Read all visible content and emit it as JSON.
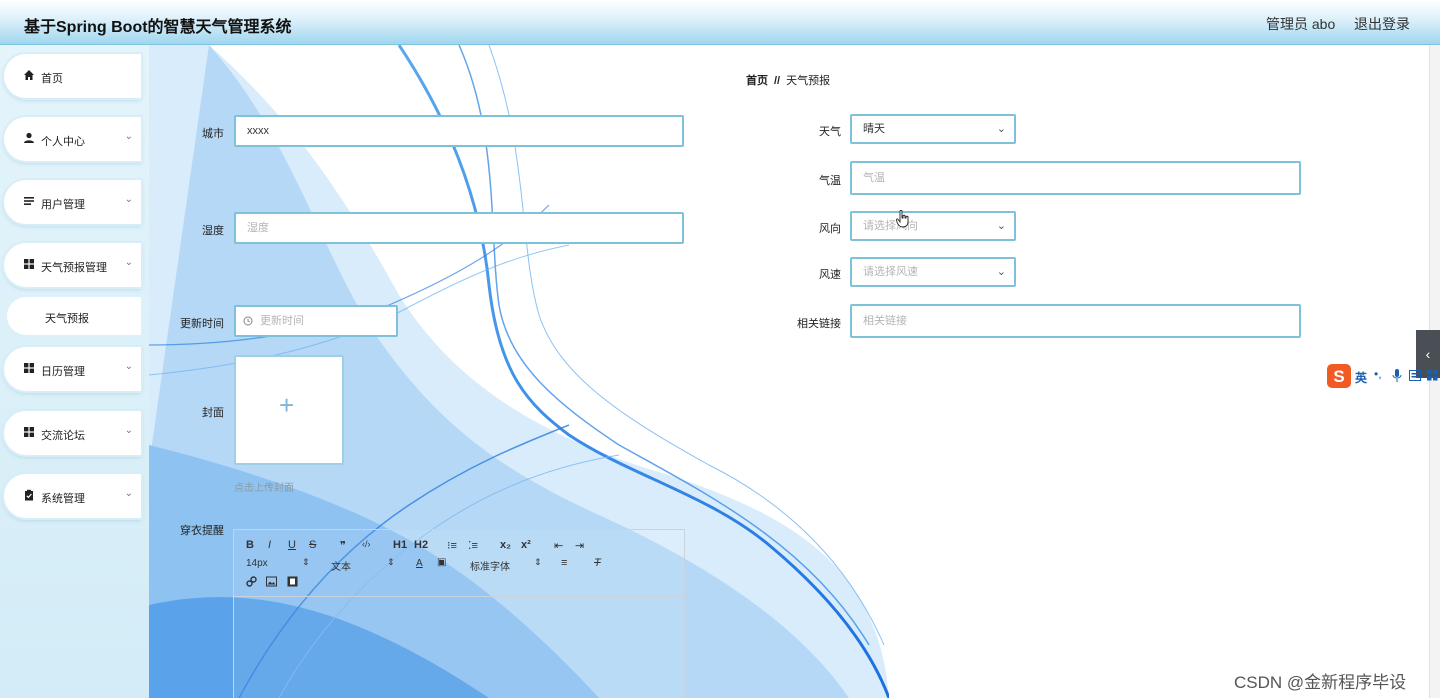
{
  "header": {
    "title": "基于Spring Boot的智慧天气管理系统",
    "admin_label": "管理员 abo",
    "logout_label": "退出登录"
  },
  "sidebar": {
    "items": [
      {
        "label": "首页",
        "icon": "home-icon"
      },
      {
        "label": "个人中心",
        "icon": "user-icon"
      },
      {
        "label": "用户管理",
        "icon": "list-icon"
      },
      {
        "label": "天气预报管理",
        "icon": "grid-icon"
      },
      {
        "label": "日历管理",
        "icon": "grid-icon"
      },
      {
        "label": "交流论坛",
        "icon": "grid-icon"
      },
      {
        "label": "系统管理",
        "icon": "clipboard-icon"
      }
    ],
    "submenu": {
      "label": "天气预报"
    }
  },
  "breadcrumb": {
    "home": "首页",
    "separator": "//",
    "current": "天气预报"
  },
  "form": {
    "city": {
      "label": "城市",
      "value": "xxxx"
    },
    "humidity": {
      "label": "湿度",
      "placeholder": "湿度"
    },
    "update_time": {
      "label": "更新时间",
      "placeholder": "更新时间"
    },
    "cover": {
      "label": "封面",
      "hint": "点击上传封面"
    },
    "dress_tip": {
      "label": "穿衣提醒"
    },
    "weather": {
      "label": "天气",
      "value": "晴天"
    },
    "temperature": {
      "label": "气温",
      "placeholder": "气温"
    },
    "wind_direction": {
      "label": "风向",
      "placeholder": "请选择风向"
    },
    "wind_speed": {
      "label": "风速",
      "placeholder": "请选择风速"
    },
    "link": {
      "label": "相关链接",
      "placeholder": "相关链接"
    }
  },
  "editor": {
    "font_size": "14px",
    "text_style": "文本",
    "font_family": "标准字体",
    "buttons": [
      "B",
      "I",
      "U",
      "S",
      "❞",
      "‹/›",
      "H1",
      "H2",
      "x₂",
      "x²"
    ]
  },
  "ime": {
    "label": "英"
  },
  "watermark": "CSDN @金新程序毕设",
  "colors": {
    "accent_border": "#7fc0da",
    "header_bottom": "#9fd6ef",
    "sidebar_bg": "#d3ecf7"
  }
}
